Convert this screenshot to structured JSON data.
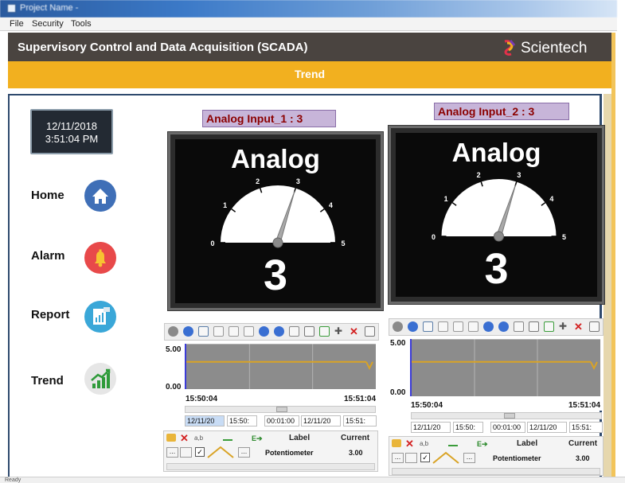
{
  "window": {
    "title": "Project Name -"
  },
  "menu": [
    "File",
    "Security",
    "Tools"
  ],
  "header": {
    "title": "Supervisory Control and Data Acquisition (SCADA)",
    "brand": "Scientech"
  },
  "page": {
    "title": "Trend"
  },
  "datetime": {
    "date": "12/11/2018",
    "time": "3:51:04 PM"
  },
  "nav": [
    {
      "label": "Home",
      "icon": "home-icon",
      "color": "#3f6fb7"
    },
    {
      "label": "Alarm",
      "icon": "bell-icon",
      "color": "#e8494a"
    },
    {
      "label": "Report",
      "icon": "report-icon",
      "color": "#3aa7d8"
    },
    {
      "label": "Trend",
      "icon": "trend-icon",
      "color": "#e6e6e6"
    }
  ],
  "gauges": [
    {
      "label": "Analog Input_1 : 3",
      "title": "Analog",
      "value": "3",
      "ticks": [
        "0",
        "1",
        "2",
        "3",
        "4",
        "5"
      ],
      "reading": 3,
      "range": [
        0,
        5
      ]
    },
    {
      "label": "Analog Input_2 : 3",
      "title": "Analog",
      "value": "3",
      "ticks": [
        "0",
        "1",
        "2",
        "3",
        "4",
        "5"
      ],
      "reading": 3,
      "range": [
        0,
        5
      ]
    }
  ],
  "trends": [
    {
      "y_max": "5.00",
      "y_min": "0.00",
      "x_start": "15:50:04",
      "x_end": "15:51:04",
      "controls": {
        "start_date": "12/11/20",
        "start_time": "15:50:",
        "duration": "00:01:00",
        "end_date": "12/11/20",
        "end_time": "15:51:"
      },
      "legend": {
        "label_header": "Label",
        "current_header": "Current",
        "label": "Potentiometer",
        "current": "3.00"
      }
    },
    {
      "y_max": "5.00",
      "y_min": "0.00",
      "x_start": "15:50:04",
      "x_end": "15:51:04",
      "controls": {
        "start_date": "12/11/20",
        "start_time": "15:50:",
        "duration": "00:01:00",
        "end_date": "12/11/20",
        "end_time": "15:51:"
      },
      "legend": {
        "label_header": "Label",
        "current_header": "Current",
        "label": "Potentiometer",
        "current": "3.00"
      }
    }
  ],
  "chart_data": [
    {
      "type": "line",
      "series": [
        {
          "name": "Potentiometer",
          "color": "#d9a325",
          "x": [
            "15:50:04",
            "15:51:04"
          ],
          "values": [
            3.0,
            3.0
          ]
        }
      ],
      "ylim": [
        0,
        5
      ]
    },
    {
      "type": "line",
      "series": [
        {
          "name": "Potentiometer",
          "color": "#d9a325",
          "x": [
            "15:50:04",
            "15:51:04"
          ],
          "values": [
            3.0,
            3.0
          ]
        }
      ],
      "ylim": [
        0,
        5
      ]
    }
  ],
  "status": {
    "text": "Ready"
  }
}
